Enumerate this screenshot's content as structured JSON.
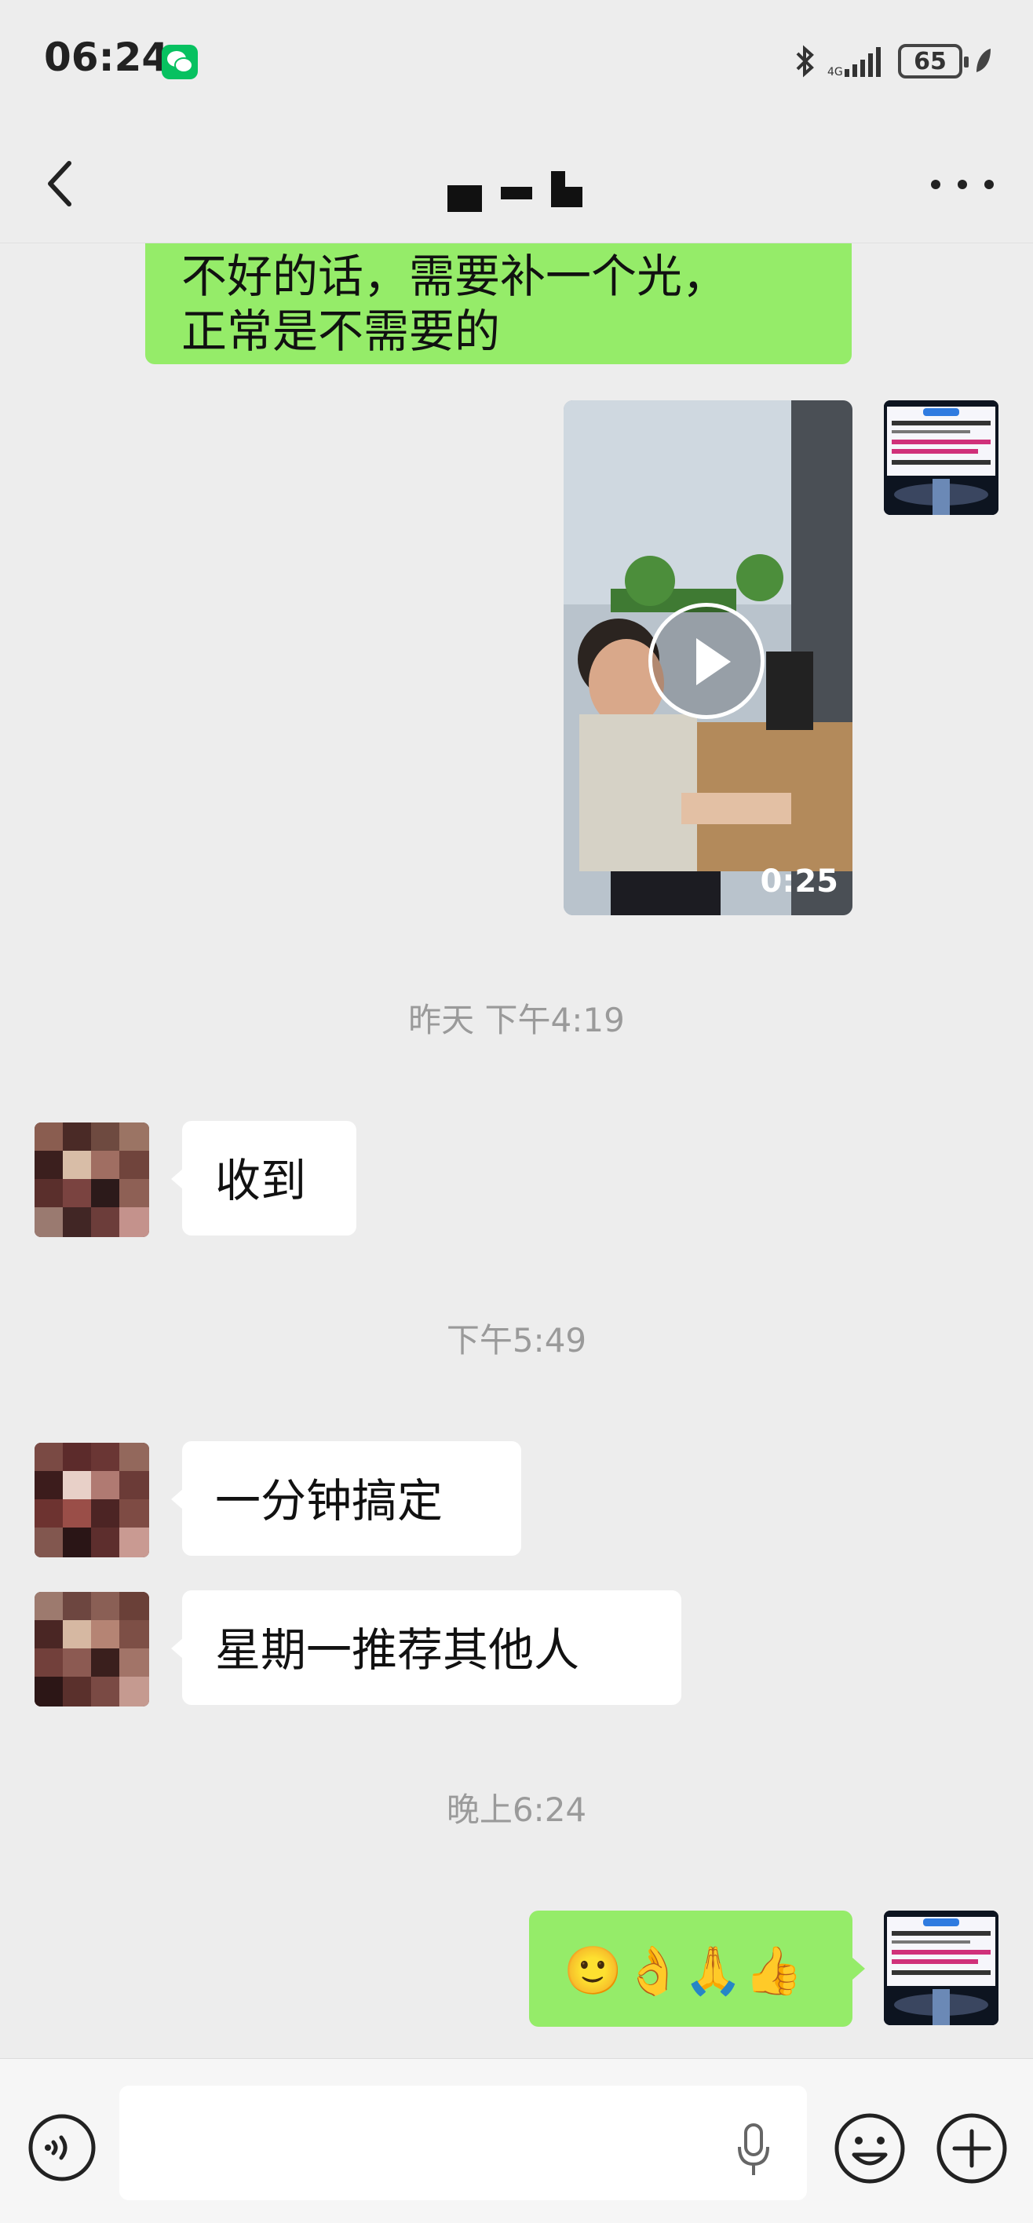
{
  "status": {
    "time": "06:24",
    "battery": "65"
  },
  "header": {
    "back_icon": "chevron-left-icon",
    "more_icon": "more-dots-icon"
  },
  "messages": {
    "top_partial_line1": "不好的话，需要补一个光，",
    "top_partial_line2": "正常是不需要的",
    "video_duration": "0:25",
    "ts1": "昨天 下午4:19",
    "msg_received_1": "收到",
    "ts2": "下午5:49",
    "msg_received_2": "一分钟搞定",
    "msg_received_3": "星期一推荐其他人",
    "ts3": "晚上6:24",
    "msg_sent_emoji": "🙂👌🙏👍"
  },
  "input": {
    "placeholder": "",
    "value": ""
  },
  "colors": {
    "sent_bubble": "#95ec69",
    "received_bubble": "#ffffff",
    "background": "#ededed"
  }
}
